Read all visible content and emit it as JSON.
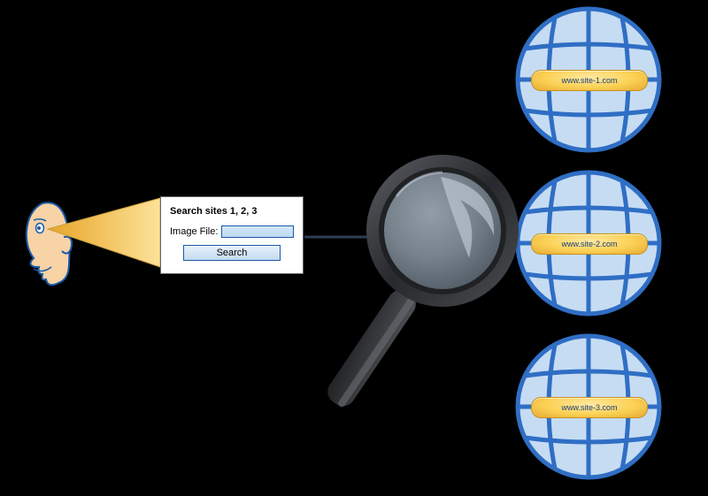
{
  "form": {
    "title": "Search sites 1, 2, 3",
    "file_label": "Image File:",
    "file_value": "",
    "search_button": "Search"
  },
  "sites": [
    {
      "url": "www.site-1.com"
    },
    {
      "url": "www.site-2.com"
    },
    {
      "url": "www.site-3.com"
    }
  ],
  "colors": {
    "globe_fill": "#c6dcf3",
    "globe_stroke": "#2f6ec4",
    "pill_fill": "#fbd154",
    "pill_text": "#1b3f7a",
    "magnifier_dark": "#323336",
    "magnifier_light": "#4d4f53",
    "face_fill": "#f7d3a6",
    "face_stroke": "#1c5aa6",
    "cone_fill": "#f3c24a"
  }
}
